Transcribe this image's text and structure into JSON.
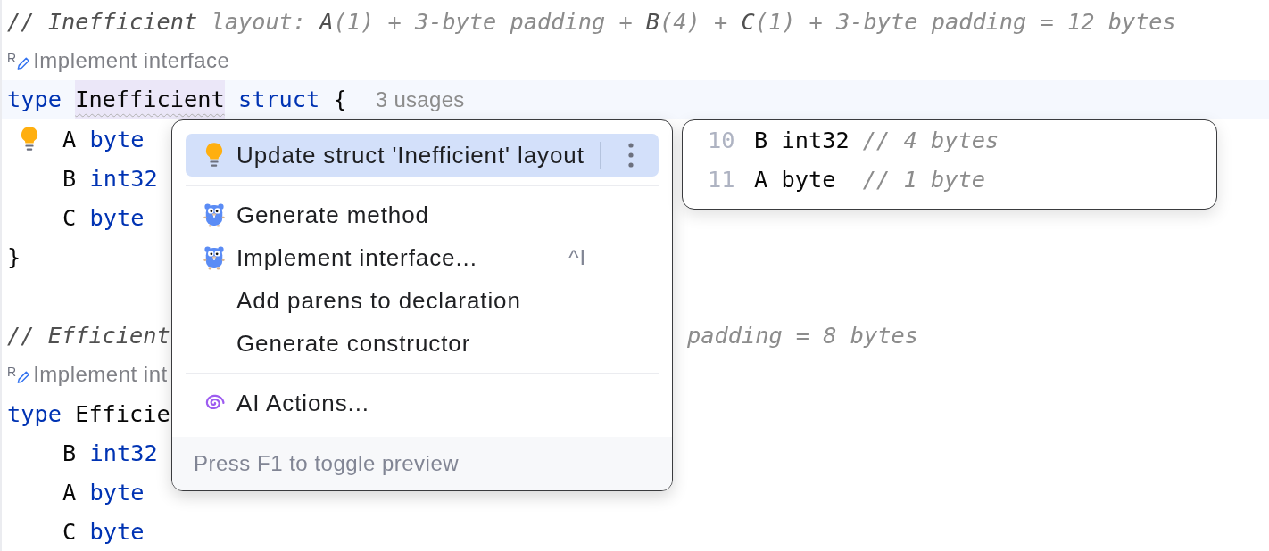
{
  "editor": {
    "lines": [
      {
        "kind": "code",
        "caret_line": false,
        "tokens": [
          {
            "text": "// Inefficient",
            "kind": "comment_ref"
          },
          {
            "text": " layout: ",
            "kind": "comment"
          },
          {
            "text": "A",
            "kind": "comment_ref"
          },
          {
            "text": "(1) + 3-byte padding + ",
            "kind": "comment"
          },
          {
            "text": "B",
            "kind": "comment_ref"
          },
          {
            "text": "(4) + ",
            "kind": "comment"
          },
          {
            "text": "C",
            "kind": "comment_ref"
          },
          {
            "text": "(1) + 3-byte padding = 12 bytes",
            "kind": "comment"
          }
        ]
      },
      {
        "kind": "hint",
        "letter": "R",
        "text": "Implement interface"
      },
      {
        "kind": "code",
        "caret_line": true,
        "tokens": [
          {
            "text": "type ",
            "kind": "keyword"
          },
          {
            "text": "Inefficient",
            "kind": "declaration"
          },
          {
            "text": " struct",
            "kind": "keyword"
          },
          {
            "text": " {",
            "kind": "plain"
          }
        ],
        "usages": "3 usages",
        "children": [
          {
            "kind": "code",
            "intention_bulb": true,
            "tokens": [
              {
                "text": "A ",
                "kind": "plain"
              },
              {
                "text": "byte",
                "kind": "keyword"
              }
            ]
          },
          {
            "kind": "code",
            "intention_bulb": false,
            "tokens": [
              {
                "text": "B ",
                "kind": "plain"
              },
              {
                "text": "int32",
                "kind": "keyword"
              }
            ]
          },
          {
            "kind": "code",
            "intention_bulb": false,
            "tokens": [
              {
                "text": "C ",
                "kind": "plain"
              },
              {
                "text": "byte",
                "kind": "keyword"
              }
            ]
          }
        ]
      },
      {
        "kind": "code",
        "caret_line": false,
        "tokens": [
          {
            "text": "}",
            "kind": "plain"
          }
        ]
      },
      {
        "kind": "blank"
      },
      {
        "kind": "code",
        "caret_line": false,
        "tokens": [
          {
            "text": "// Efficient",
            "kind": "comment_ref"
          }
        ],
        "tokens_right": [
          {
            "text": "padding = 8 bytes",
            "kind": "comment"
          }
        ]
      },
      {
        "kind": "hint",
        "letter": "R",
        "text": "Implement int"
      },
      {
        "kind": "code",
        "caret_line": false,
        "tokens": [
          {
            "text": "type ",
            "kind": "keyword"
          },
          {
            "text": "Efficie",
            "kind": "plain"
          }
        ],
        "children": [
          {
            "kind": "code",
            "intention_bulb": false,
            "tokens": [
              {
                "text": "B ",
                "kind": "plain"
              },
              {
                "text": "int32",
                "kind": "keyword"
              }
            ]
          },
          {
            "kind": "code",
            "intention_bulb": false,
            "tokens": [
              {
                "text": "A ",
                "kind": "plain"
              },
              {
                "text": "byte",
                "kind": "keyword"
              }
            ]
          },
          {
            "kind": "code",
            "intention_bulb": false,
            "tokens": [
              {
                "text": "C ",
                "kind": "plain"
              },
              {
                "text": "byte",
                "kind": "keyword"
              }
            ]
          }
        ]
      }
    ]
  },
  "intention_popup": {
    "groups": [
      [
        {
          "kind": "fix",
          "label": "Update struct 'Inefficient' layout",
          "selected": true
        }
      ],
      [
        {
          "kind": "go",
          "label": "Generate method",
          "selected": false
        },
        {
          "kind": "go",
          "label": "Implement interface...",
          "shortcut": "^I",
          "selected": false
        },
        {
          "kind": "plain",
          "label": "Add parens to declaration",
          "selected": false
        },
        {
          "kind": "plain",
          "label": "Generate constructor",
          "selected": false
        }
      ],
      [
        {
          "kind": "ai",
          "label": "AI Actions...",
          "selected": false
        }
      ]
    ],
    "footer": "Press F1 to toggle preview"
  },
  "preview": {
    "lines": [
      {
        "number": "10",
        "tokens": [
          {
            "text": "B int32 ",
            "kind": "plain"
          },
          {
            "text": "// 4 bytes",
            "kind": "comment"
          }
        ]
      },
      {
        "number": "11",
        "tokens": [
          {
            "text": "A byte  ",
            "kind": "plain"
          },
          {
            "text": "// 1 byte",
            "kind": "comment"
          }
        ]
      }
    ]
  }
}
